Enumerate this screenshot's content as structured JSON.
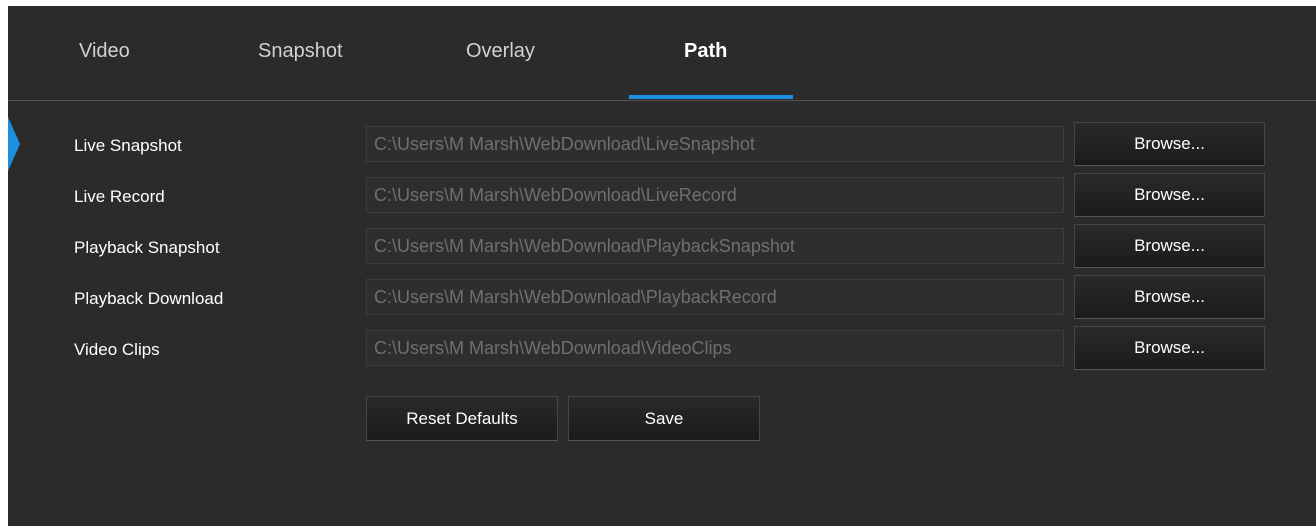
{
  "tabs": [
    {
      "label": "Video",
      "active": false
    },
    {
      "label": "Snapshot",
      "active": false
    },
    {
      "label": "Overlay",
      "active": false
    },
    {
      "label": "Path",
      "active": true
    }
  ],
  "rows": [
    {
      "label": "Live Snapshot",
      "value": "C:\\Users\\M Marsh\\WebDownload\\LiveSnapshot",
      "button": "Browse..."
    },
    {
      "label": "Live Record",
      "value": "C:\\Users\\M Marsh\\WebDownload\\LiveRecord",
      "button": "Browse..."
    },
    {
      "label": "Playback Snapshot",
      "value": "C:\\Users\\M Marsh\\WebDownload\\PlaybackSnapshot",
      "button": "Browse..."
    },
    {
      "label": "Playback Download",
      "value": "C:\\Users\\M Marsh\\WebDownload\\PlaybackRecord",
      "button": "Browse..."
    },
    {
      "label": "Video Clips",
      "value": "C:\\Users\\M Marsh\\WebDownload\\VideoClips",
      "button": "Browse..."
    }
  ],
  "actions": {
    "reset_label": "Reset Defaults",
    "save_label": "Save"
  },
  "colors": {
    "accent": "#1c8fe0",
    "panel_background": "#2b2b2b",
    "field_text": "#6f6f6f"
  }
}
